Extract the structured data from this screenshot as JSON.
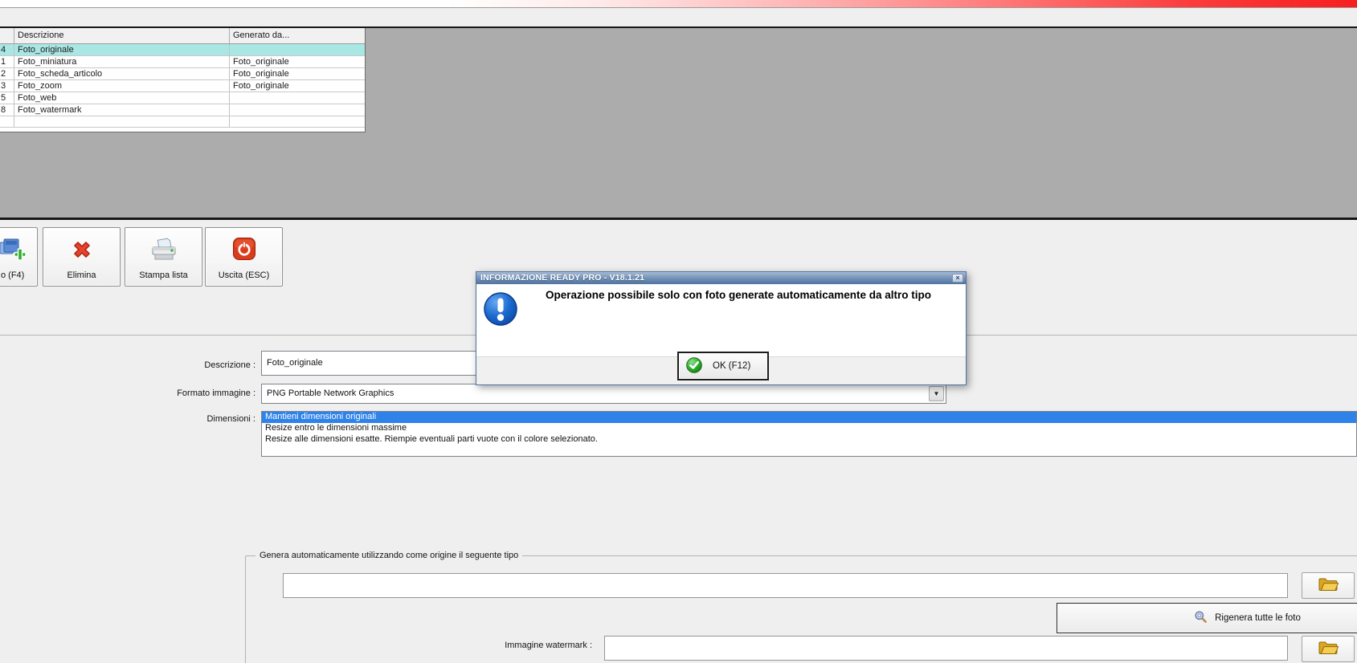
{
  "photo_types_table": {
    "headers": {
      "id": "",
      "descrizione": "Descrizione",
      "generato_da": "Generato da..."
    },
    "rows": [
      {
        "id": "4",
        "descrizione": "Foto_originale",
        "generato_da": "",
        "selected": true
      },
      {
        "id": "1",
        "descrizione": "Foto_miniatura",
        "generato_da": "Foto_originale"
      },
      {
        "id": "2",
        "descrizione": "Foto_scheda_articolo",
        "generato_da": "Foto_originale"
      },
      {
        "id": "3",
        "descrizione": "Foto_zoom",
        "generato_da": "Foto_originale"
      },
      {
        "id": "5",
        "descrizione": "Foto_web",
        "generato_da": ""
      },
      {
        "id": "8",
        "descrizione": "Foto_watermark",
        "generato_da": ""
      }
    ],
    "selected_row_color": "#a9e7e4"
  },
  "toolbar": {
    "new_label": "o (F4)",
    "delete_label": "Elimina",
    "print_label": "Stampa lista",
    "exit_label": "Uscita (ESC)"
  },
  "form": {
    "descrizione_label": "Descrizione :",
    "descrizione_value": "Foto_originale",
    "formato_label": "Formato immagine :",
    "formato_value": "PNG Portable Network Graphics",
    "dimensioni_label": "Dimensioni :",
    "dimensioni_options": [
      "Mantieni dimensioni originali",
      "Resize entro le dimensioni massime",
      "Resize alle dimensioni esatte. Riempie eventuali parti vuote con il colore selezionato."
    ],
    "dimensioni_selected_index": 0,
    "group_legend": "Genera automaticamente utilizzando come origine il seguente tipo",
    "origine_value": "",
    "rigenera_label": "Rigenera tutte le foto",
    "watermark_label": "Immagine watermark :",
    "watermark_value": ""
  },
  "dialog": {
    "title": "INFORMAZIONE READY PRO - V18.1.21",
    "message": "Operazione possibile solo con foto generate automaticamente da altro tipo",
    "ok_label": "OK (F12)"
  },
  "glyphs": {
    "close": "×",
    "combo_arrow": "▼"
  },
  "colors": {
    "selection_blue": "#2e82e8",
    "selected_row_cyan": "#a9e7e4",
    "titlebar_blue": "#6d8fb4",
    "accent_red": "#e8422c",
    "band_red": "#f71f1f"
  }
}
